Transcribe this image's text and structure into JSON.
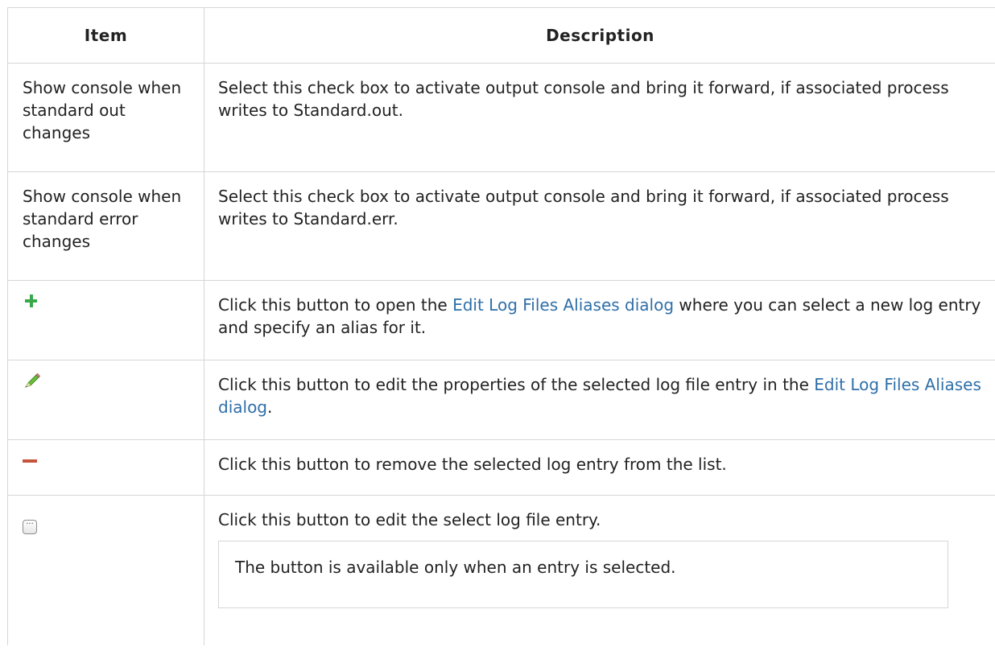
{
  "header": {
    "item": "Item",
    "description": "Description"
  },
  "rows": [
    {
      "item": "Show console when standard out changes",
      "desc": "Select this check box to activate output console and bring it forward, if associated process writes to Standard.out."
    },
    {
      "item": "Show console when standard error changes",
      "desc": "Select this check box to activate output console and bring it forward, if associated process writes to Standard.err."
    },
    {
      "icon": "plus-icon",
      "desc_before": "Click this button to open the ",
      "link": "Edit Log Files Aliases dialog",
      "desc_after": " where you can select a new log entry and specify an alias for it."
    },
    {
      "icon": "pencil-icon",
      "desc_before": "Click this button to edit the properties of the selected log file entry in the ",
      "link": "Edit Log Files Aliases dialog",
      "desc_after": "."
    },
    {
      "icon": "minus-icon",
      "desc": "Click this button to remove the selected log entry from the list."
    },
    {
      "icon": "ellipsis-icon",
      "desc": "Click this button to edit the select log file entry.",
      "note": "The button is available only when an entry is selected."
    }
  ],
  "colors": {
    "link": "#2f6fa8",
    "plus": "#3aa84a",
    "minus": "#c6543d",
    "border": "#d6d6d6"
  }
}
